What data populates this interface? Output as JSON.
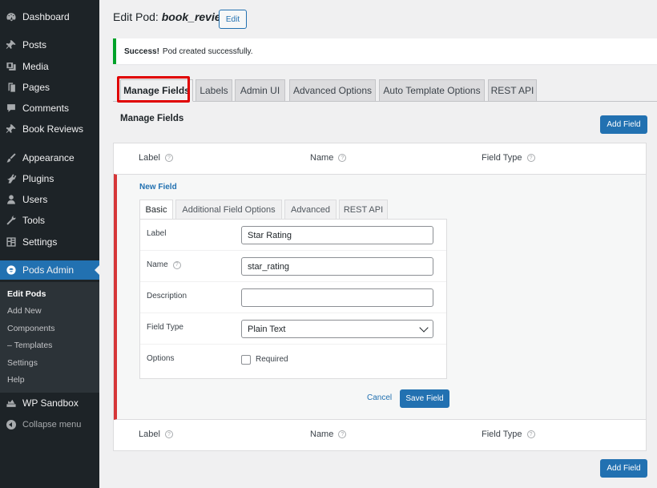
{
  "sidebar": {
    "items": [
      {
        "label": "Dashboard",
        "icon": "dashboard-icon"
      },
      {
        "label": "Posts",
        "icon": "pin-icon"
      },
      {
        "label": "Media",
        "icon": "media-icon"
      },
      {
        "label": "Pages",
        "icon": "pages-icon"
      },
      {
        "label": "Comments",
        "icon": "comment-icon"
      },
      {
        "label": "Book Reviews",
        "icon": "pin-icon"
      },
      {
        "label": "Appearance",
        "icon": "brush-icon"
      },
      {
        "label": "Plugins",
        "icon": "plug-icon"
      },
      {
        "label": "Users",
        "icon": "user-icon"
      },
      {
        "label": "Tools",
        "icon": "wrench-icon"
      },
      {
        "label": "Settings",
        "icon": "settings-icon"
      },
      {
        "label": "Pods Admin",
        "icon": "pods-icon"
      },
      {
        "label": "WP Sandbox",
        "icon": "sandbox-icon"
      }
    ],
    "submenu": [
      "Edit Pods",
      "Add New",
      "Components",
      "– Templates",
      "Settings",
      "Help"
    ],
    "collapse_label": "Collapse menu"
  },
  "header": {
    "title_prefix": "Edit Pod:",
    "pod_name": "book_review",
    "edit_button": "Edit"
  },
  "notice": {
    "strong": "Success!",
    "text": "Pod created successfully."
  },
  "tabs": [
    "Manage Fields",
    "Labels",
    "Admin UI",
    "Advanced Options",
    "Auto Template Options",
    "REST API"
  ],
  "manage": {
    "title": "Manage Fields",
    "add_field": "Add Field",
    "columns": [
      "Label",
      "Name",
      "Field Type"
    ],
    "help_glyph": "?"
  },
  "editor": {
    "new_field": "New Field",
    "tabs": [
      "Basic",
      "Additional Field Options",
      "Advanced",
      "REST API"
    ],
    "rows": {
      "label": {
        "label": "Label",
        "value": "Star Rating"
      },
      "name": {
        "label": "Name",
        "value": "star_rating"
      },
      "description": {
        "label": "Description",
        "value": ""
      },
      "field_type": {
        "label": "Field Type",
        "value": "Plain Text"
      },
      "options": {
        "label": "Options",
        "checkbox_label": "Required",
        "checked": false
      }
    },
    "cancel": "Cancel",
    "save": "Save Field"
  },
  "colors": {
    "sidebar_bg": "#1d2327",
    "accent": "#2271b1",
    "success": "#00a32a",
    "highlight_box": "#e00000",
    "edit_bar": "#d63638"
  }
}
